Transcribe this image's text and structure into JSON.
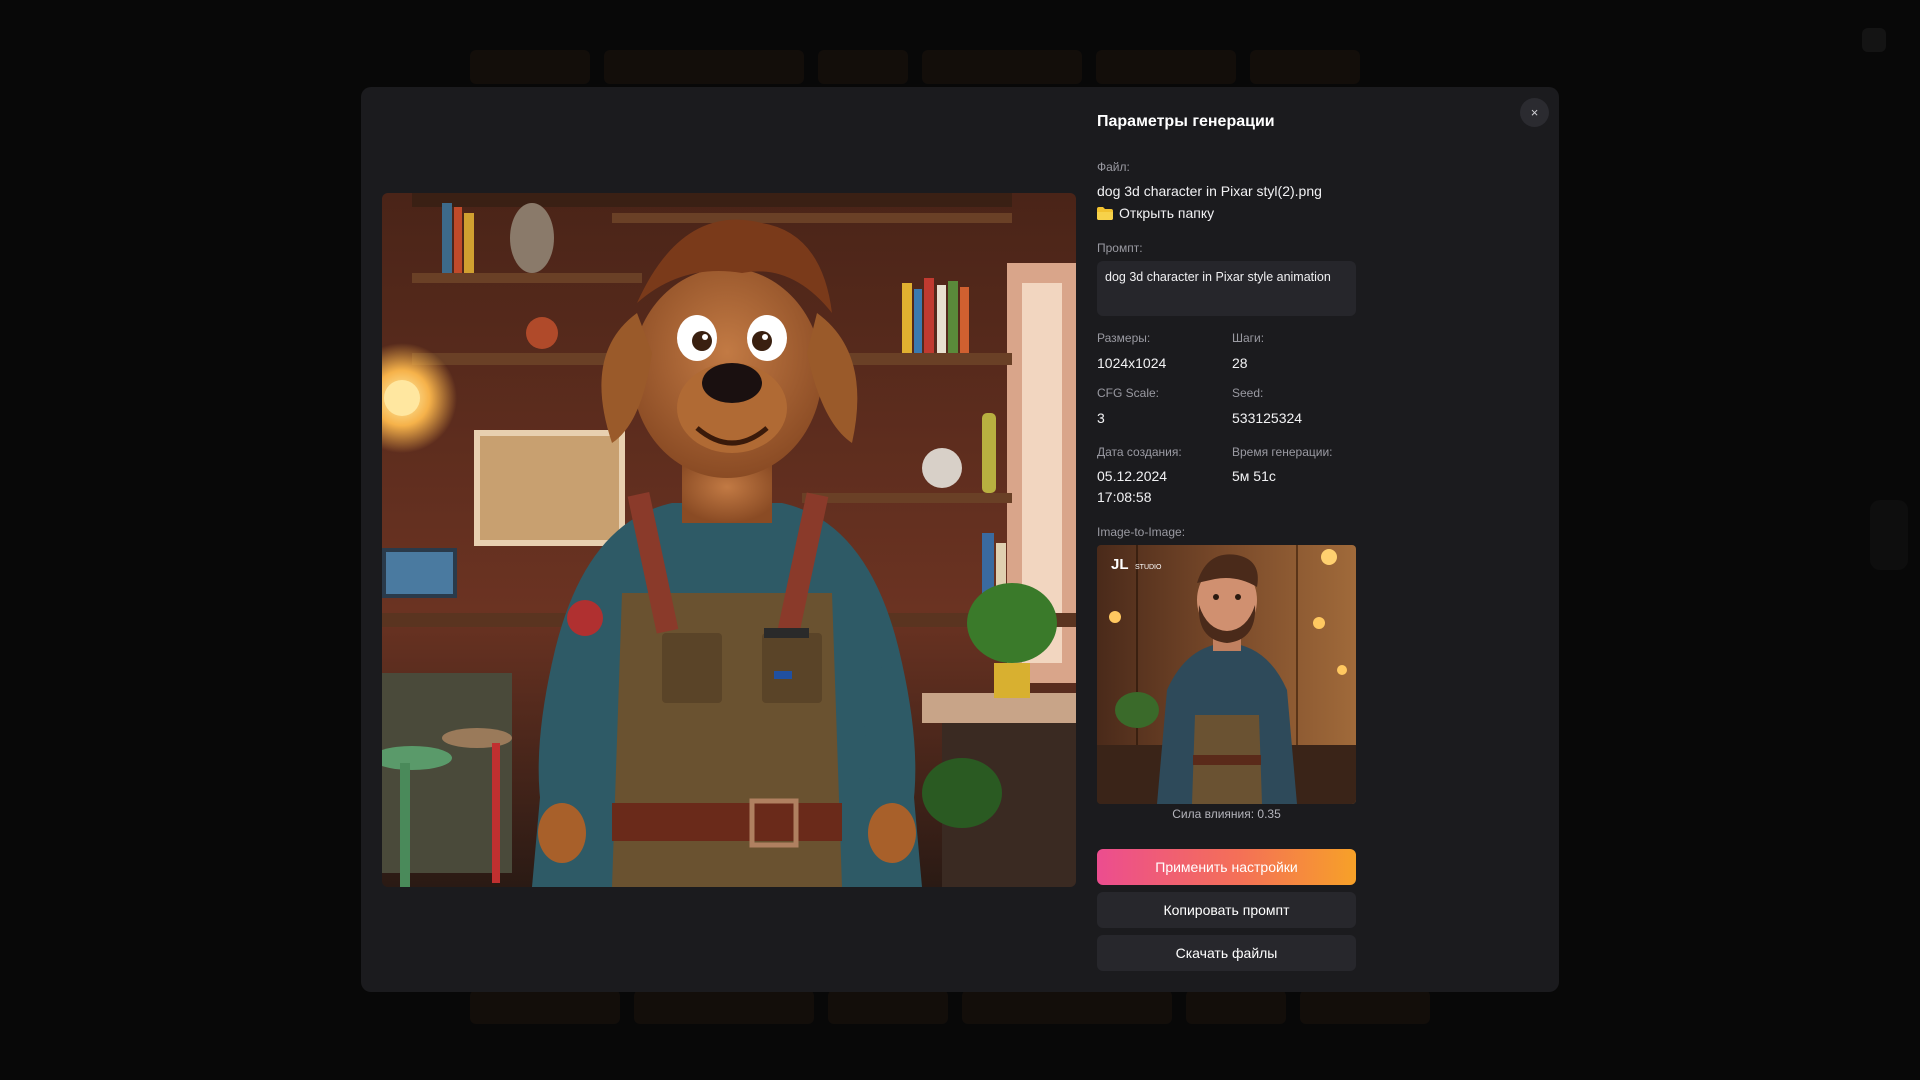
{
  "modal": {
    "title": "Параметры генерации",
    "close_label": "×"
  },
  "file": {
    "label": "Файл:",
    "name": "dog 3d character in Pixar styl(2).png",
    "open_folder_label": "Открыть папку"
  },
  "prompt": {
    "label": "Промпт:",
    "text": "dog 3d character in Pixar style animation"
  },
  "params": {
    "size_label": "Размеры:",
    "size_value": "1024x1024",
    "steps_label": "Шаги:",
    "steps_value": "28",
    "cfg_label": "CFG Scale:",
    "cfg_value": "3",
    "seed_label": "Seed:",
    "seed_value": "533125324",
    "date_label": "Дата создания:",
    "date_value": "05.12.2024",
    "time_value": "17:08:58",
    "gen_time_label": "Время генерации:",
    "gen_time_value": "5м 51с"
  },
  "img2img": {
    "label": "Image-to-Image:",
    "influence": "Сила влияния: 0.35",
    "logo_text": "JL",
    "logo_sub": "STUDIO"
  },
  "actions": {
    "apply_label": "Применить настройки",
    "copy_label": "Копировать промпт",
    "download_label": "Скачать файлы"
  },
  "icons": {
    "close": "close-icon",
    "folder": "folder-icon"
  },
  "colors": {
    "modal_bg": "#1b1b1e",
    "primary_gradient_start": "#ec4d8f",
    "primary_gradient_end": "#f7a128",
    "secondary_btn": "#27272c"
  }
}
